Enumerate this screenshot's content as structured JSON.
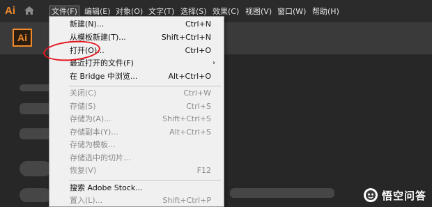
{
  "app": {
    "logo": "Ai",
    "badge": "Ai"
  },
  "menubar": {
    "items": [
      "文件(F)",
      "编辑(E)",
      "对象(O)",
      "文字(T)",
      "选择(S)",
      "效果(C)",
      "视图(V)",
      "窗口(W)",
      "帮助(H)"
    ]
  },
  "file_menu": {
    "items": [
      {
        "label": "新建(N)...",
        "shortcut": "Ctrl+N",
        "enabled": true
      },
      {
        "label": "从模板新建(T)...",
        "shortcut": "Shift+Ctrl+N",
        "enabled": true
      },
      {
        "label": "打开(O)...",
        "shortcut": "Ctrl+O",
        "enabled": true
      },
      {
        "label": "最近打开的文件(F)",
        "shortcut": "",
        "enabled": true,
        "submenu": true
      },
      {
        "label": "在 Bridge 中浏览...",
        "shortcut": "Alt+Ctrl+O",
        "enabled": true
      },
      {
        "label": "关闭(C)",
        "shortcut": "Ctrl+W",
        "enabled": false
      },
      {
        "label": "存储(S)",
        "shortcut": "Ctrl+S",
        "enabled": false
      },
      {
        "label": "存储为(A)...",
        "shortcut": "Shift+Ctrl+S",
        "enabled": false
      },
      {
        "label": "存储副本(Y)...",
        "shortcut": "Alt+Ctrl+S",
        "enabled": false
      },
      {
        "label": "存储为模板...",
        "shortcut": "",
        "enabled": false
      },
      {
        "label": "存储选中的切片...",
        "shortcut": "",
        "enabled": false
      },
      {
        "label": "恢复(V)",
        "shortcut": "F12",
        "enabled": false
      },
      {
        "label": "搜索 Adobe Stock...",
        "shortcut": "",
        "enabled": true
      },
      {
        "label": "置入(L)...",
        "shortcut": "Shift+Ctrl+P",
        "enabled": false
      }
    ]
  },
  "watermark": {
    "text": "悟空问答"
  },
  "colors": {
    "accent_orange": "#f08a2b",
    "annotation_red": "#e3141f"
  }
}
